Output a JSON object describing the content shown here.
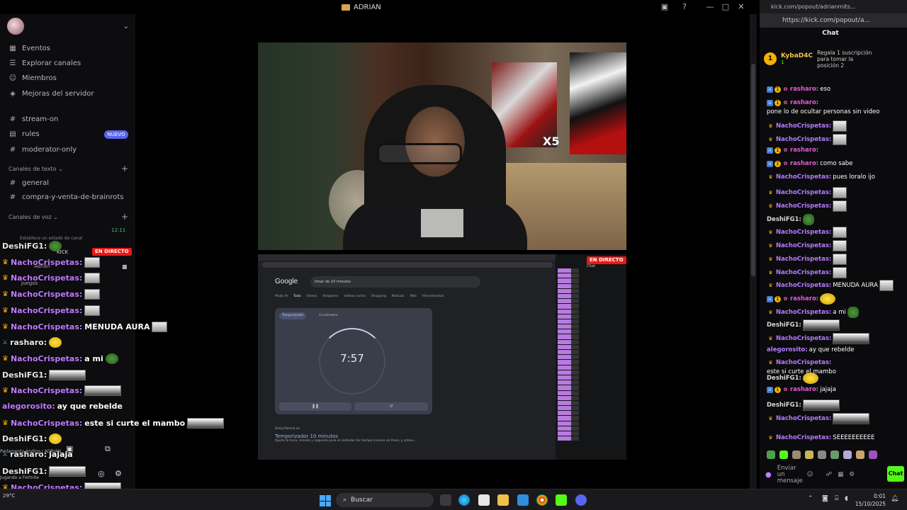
{
  "discord": {
    "window_title": "ADRIAN",
    "server_name": "",
    "nav": [
      {
        "label": "Eventos",
        "icon": "calendar-icon"
      },
      {
        "label": "Explorar canales",
        "icon": "list-icon"
      },
      {
        "label": "Miembros",
        "icon": "members-icon"
      },
      {
        "label": "Mejoras del servidor",
        "icon": "boost-icon"
      }
    ],
    "channels": [
      {
        "label": "stream-on",
        "icon": "hash-icon"
      },
      {
        "label": "rules",
        "icon": "rules-icon",
        "badge": "NUEVO"
      },
      {
        "label": "moderator-only",
        "icon": "hash-icon"
      }
    ],
    "text_category": "Canales de texto",
    "text_channels": [
      "general",
      "compra-y-venta-de-brainrots"
    ],
    "voice_category": "Canales de voz",
    "voice_time": "12:11",
    "voice_status": "Establece un estado de canal",
    "voice_kick": "KICK",
    "voice_user": "Adrian",
    "voice_games": "Juegos",
    "voice_live": "EN DIRECTO",
    "voice_footer": "Parlamento Andino / ADRIAN",
    "voice_activity": "Jugando a Fortnite"
  },
  "overlay_chat": [
    {
      "user": "DeshiFG1:",
      "msg": "",
      "emote": "pepe",
      "badge": ""
    },
    {
      "user": "NachoCrispetas:",
      "msg": "",
      "emote": "img",
      "badge": "crown"
    },
    {
      "user": "NachoCrispetas:",
      "msg": "",
      "emote": "img",
      "badge": "crown"
    },
    {
      "user": "NachoCrispetas:",
      "msg": "",
      "emote": "img",
      "badge": "crown"
    },
    {
      "user": "NachoCrispetas:",
      "msg": "",
      "emote": "img",
      "badge": "crown"
    },
    {
      "user": "NachoCrispetas:",
      "msg": "MENUDA AURA",
      "emote": "img",
      "badge": "crown"
    },
    {
      "user": "rasharo:",
      "msg": "",
      "emote": "yel",
      "badge": "mod"
    },
    {
      "user": "NachoCrispetas:",
      "msg": "a mi",
      "emote": "pepe",
      "badge": "crown"
    },
    {
      "user": "DeshiFG1:",
      "msg": "",
      "emote": "wide",
      "badge": ""
    },
    {
      "user": "NachoCrispetas:",
      "msg": "",
      "emote": "wide",
      "badge": "crown"
    },
    {
      "user": "alegorosito:",
      "msg": "ay que rebelde",
      "emote": "",
      "badge": ""
    },
    {
      "user": "NachoCrispetas:",
      "msg": "este si curte el mambo",
      "emote": "wide",
      "badge": "crown"
    },
    {
      "user": "DeshiFG1:",
      "msg": "",
      "emote": "yel",
      "badge": ""
    },
    {
      "user": "rasharo:",
      "msg": "jajaja",
      "emote": "",
      "badge": "mod"
    },
    {
      "user": "DeshiFG1:",
      "msg": "",
      "emote": "wide",
      "badge": ""
    },
    {
      "user": "NachoCrispetas:",
      "msg": "",
      "emote": "wide",
      "badge": "crown"
    },
    {
      "user": "NachoCrispetas:",
      "msg": "SEEEEEEEEEE",
      "emote": "",
      "badge": "crown"
    }
  ],
  "stream": {
    "cam_overlay": "X5",
    "live_badge": "EN DIRECTO",
    "google_logo": "Google",
    "search_query": "timer de 10 minutos",
    "search_tabs": [
      "Modo IA",
      "Todo",
      "Videos",
      "Imágenes",
      "Videos cortos",
      "Shopping",
      "Noticias",
      "Más",
      "Herramientas"
    ],
    "timer_tab": "Temporizador",
    "stopwatch_tab": "Cronómetro",
    "timer_value": "7:57",
    "result_source": "Reloj-Alarma.es",
    "result_title": "Temporizador 10 minutos",
    "result_snippet": "Ajuste la hora, minuto y segundo para el contador de tiempo inverso en línea, y active...",
    "kick_chat_title": "Chat"
  },
  "kick": {
    "tab_title": "kick.com/popout/adrianmits...",
    "url": "https://kick.com/popout/a...",
    "chat_title": "Chat",
    "gift_user": "KybaD4C",
    "gift_count": "1",
    "gift_note": "Regala 1 suscripción para tomar la posición 2",
    "messages": [
      {
        "user": "rasharo:",
        "msg": "eso",
        "style": "r",
        "badges": [
          "blue",
          "gold",
          "pink"
        ]
      },
      {
        "user": "rasharo:",
        "msg": "pone lo de ocultar personas sin video",
        "style": "r",
        "badges": [
          "blue",
          "gold",
          "pink"
        ]
      },
      {
        "user": "NachoCrispetas:",
        "msg": "",
        "style": "u",
        "badges": [
          "crown"
        ],
        "emote": "kemote"
      },
      {
        "user": "NachoCrispetas:",
        "msg": "",
        "style": "u",
        "badges": [
          "crown"
        ],
        "emote": "kemote"
      },
      {
        "user": "rasharo:",
        "msg": "",
        "style": "r",
        "badges": [
          "blue",
          "gold",
          "pink"
        ]
      },
      {
        "user": "rasharo:",
        "msg": "como sabe",
        "style": "r",
        "badges": [
          "blue",
          "gold",
          "pink"
        ]
      },
      {
        "user": "NachoCrispetas:",
        "msg": "pues loralo ijo",
        "style": "u",
        "badges": [
          "crown"
        ]
      },
      {
        "user": "NachoCrispetas:",
        "msg": "",
        "style": "u",
        "badges": [
          "crown"
        ],
        "emote": "kemote"
      },
      {
        "user": "NachoCrispetas:",
        "msg": "",
        "style": "u",
        "badges": [
          "crown"
        ],
        "emote": "kemote"
      },
      {
        "user": "DeshiFG1:",
        "msg": "",
        "style": "s",
        "badges": [],
        "emote": "kemote pepe"
      },
      {
        "user": "NachoCrispetas:",
        "msg": "",
        "style": "u",
        "badges": [
          "crown"
        ],
        "emote": "kemote"
      },
      {
        "user": "NachoCrispetas:",
        "msg": "",
        "style": "u",
        "badges": [
          "crown"
        ],
        "emote": "kemote"
      },
      {
        "user": "NachoCrispetas:",
        "msg": "",
        "style": "u",
        "badges": [
          "crown"
        ],
        "emote": "kemote"
      },
      {
        "user": "NachoCrispetas:",
        "msg": "",
        "style": "u",
        "badges": [
          "crown"
        ],
        "emote": "kemote"
      },
      {
        "user": "NachoCrispetas:",
        "msg": "MENUDA AURA",
        "style": "u",
        "badges": [
          "crown"
        ],
        "emote": "kemote"
      },
      {
        "user": "rasharo:",
        "msg": "",
        "style": "r",
        "badges": [
          "blue",
          "gold",
          "pink"
        ],
        "emote": "kemote yel"
      },
      {
        "user": "NachoCrispetas:",
        "msg": "a mi",
        "style": "u",
        "badges": [
          "crown"
        ],
        "emote": "kemote pepe"
      },
      {
        "user": "DeshiFG1:",
        "msg": "",
        "style": "s",
        "badges": [],
        "emote": "kemote wide"
      },
      {
        "user": "NachoCrispetas:",
        "msg": "",
        "style": "u",
        "badges": [
          "crown"
        ],
        "emote": "kemote wide"
      },
      {
        "user": "alegorosito:",
        "msg": "ay que rebelde",
        "style": "u",
        "badges": []
      },
      {
        "user": "NachoCrispetas:",
        "msg": "este si curte el mambo",
        "style": "u",
        "badges": [
          "crown"
        ]
      },
      {
        "user": "DeshiFG1:",
        "msg": "",
        "style": "s",
        "badges": [],
        "emote": "kemote yel"
      },
      {
        "user": "rasharo:",
        "msg": "jajaja",
        "style": "r",
        "badges": [
          "blue",
          "gold",
          "pink"
        ]
      },
      {
        "user": "DeshiFG1:",
        "msg": "",
        "style": "s",
        "badges": [],
        "emote": "kemote wide"
      },
      {
        "user": "NachoCrispetas:",
        "msg": "",
        "style": "u",
        "badges": [
          "crown"
        ],
        "emote": "kemote wide"
      },
      {
        "user": "NachoCrispetas:",
        "msg": "SEEEEEEEEEE",
        "style": "u",
        "badges": [
          "crown"
        ]
      }
    ],
    "input_placeholder": "Enviar un mensaje",
    "chat_button": "Chat"
  },
  "taskbar": {
    "weather": "29°C",
    "search_label": "Buscar",
    "time": "0:01",
    "date": "15/10/2025"
  },
  "colors": {
    "kick_green": "#53fc18",
    "live_red": "#e91916",
    "discord_blurple": "#5865f2",
    "username_purple": "#b57bff",
    "crown_gold": "#f5b000"
  }
}
